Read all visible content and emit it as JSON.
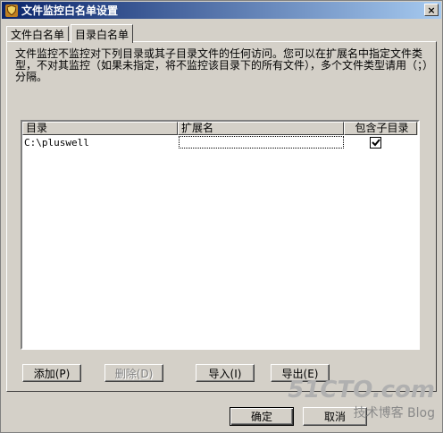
{
  "window": {
    "title": "文件监控白名单设置",
    "close_glyph": "×"
  },
  "tabs": [
    {
      "label": "文件白名单",
      "active": false
    },
    {
      "label": "目录白名单",
      "active": true
    }
  ],
  "description": "文件监控不监控对下列目录或其子目录文件的任何访问。您可以在扩展名中指定文件类型，不对其监控（如果未指定，将不监控该目录下的所有文件），多个文件类型请用（；）分隔。",
  "list": {
    "columns": [
      "目录",
      "扩展名",
      "包含子目录"
    ],
    "rows": [
      {
        "directory": "C:\\pluswell",
        "extension": "",
        "include_subdirs": true
      }
    ]
  },
  "buttons": {
    "add": "添加(P)",
    "delete": "删除(D)",
    "import": "导入(I)",
    "export": "导出(E)",
    "ok": "确定",
    "cancel": "取消"
  },
  "watermark": {
    "logo": "51CTO.com",
    "sub": "技术博客  Blog"
  }
}
